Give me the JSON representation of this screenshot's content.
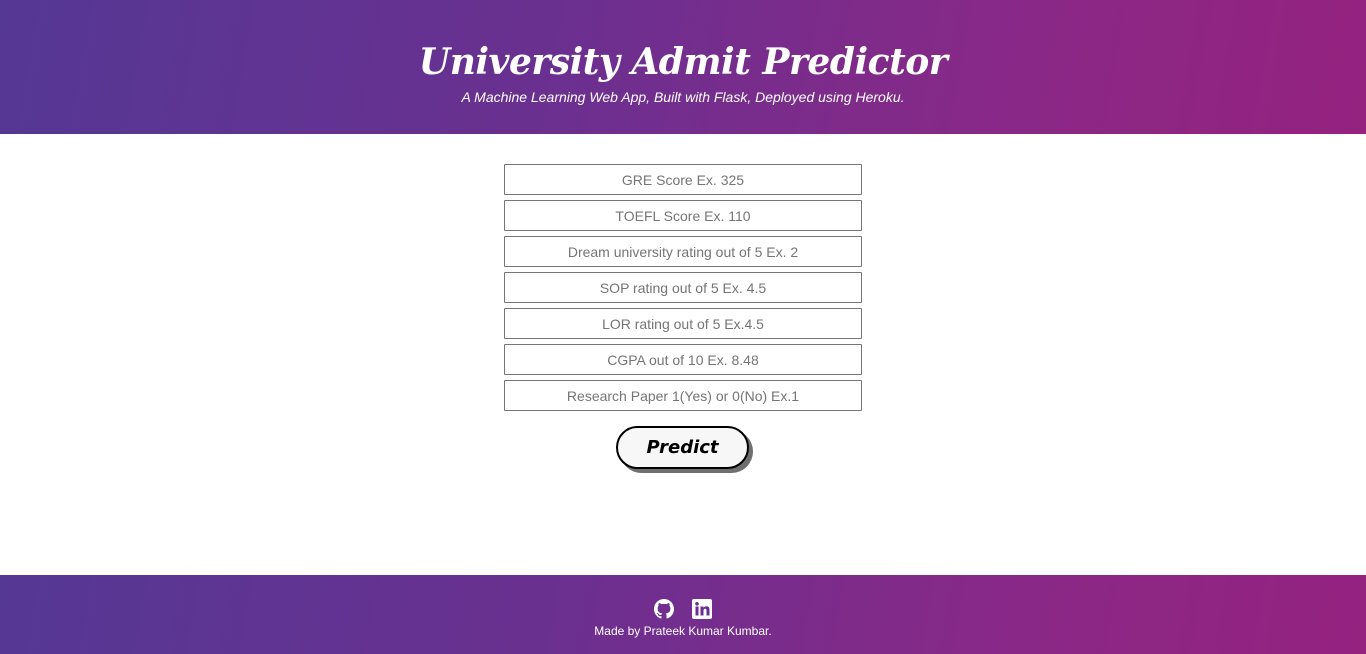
{
  "header": {
    "title": "University Admit Predictor",
    "subtitle": "A Machine Learning Web App, Built with Flask, Deployed using Heroku."
  },
  "form": {
    "fields": [
      {
        "placeholder": "GRE Score Ex. 325",
        "value": ""
      },
      {
        "placeholder": "TOEFL Score Ex. 110",
        "value": ""
      },
      {
        "placeholder": "Dream university rating out of 5 Ex. 2",
        "value": ""
      },
      {
        "placeholder": "SOP rating out of 5 Ex. 4.5",
        "value": ""
      },
      {
        "placeholder": "LOR rating out of 5 Ex.4.5",
        "value": ""
      },
      {
        "placeholder": "CGPA out of 10 Ex. 8.48",
        "value": ""
      },
      {
        "placeholder": "Research Paper 1(Yes) or 0(No) Ex.1",
        "value": ""
      }
    ],
    "predict_label": "Predict"
  },
  "footer": {
    "icons": [
      "github-icon",
      "linkedin-icon"
    ],
    "credit": "Made by Prateek Kumar Kumbar."
  },
  "colors": {
    "gradient_start": "#553894",
    "gradient_end": "#95227f"
  }
}
